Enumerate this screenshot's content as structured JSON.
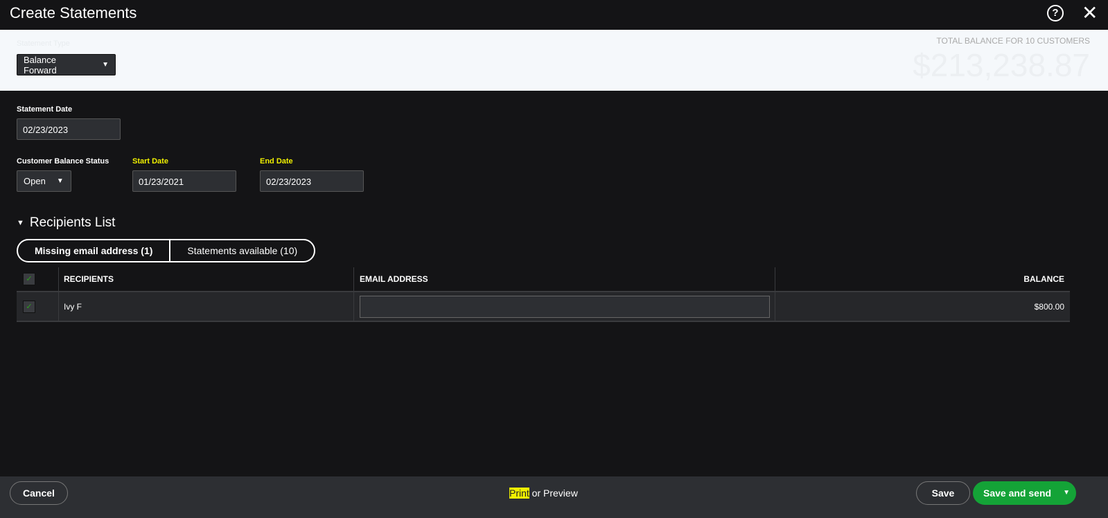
{
  "header": {
    "title": "Create Statements",
    "help_icon": "?",
    "close_icon": "✕"
  },
  "statement_type": {
    "label": "Statement Type",
    "value": "Balance Forward"
  },
  "total": {
    "label": "TOTAL BALANCE FOR 10 CUSTOMERS",
    "value": "$213,238.87"
  },
  "statement_date": {
    "label": "Statement Date",
    "value": "02/23/2023"
  },
  "balance_status": {
    "label": "Customer Balance Status",
    "value": "Open"
  },
  "start_date": {
    "label": "Start Date",
    "value": "01/23/2021"
  },
  "end_date": {
    "label": "End Date",
    "value": "02/23/2023"
  },
  "recipients": {
    "title": "Recipients List",
    "tabs": [
      {
        "label": "Missing email address (1)"
      },
      {
        "label": "Statements available (10)"
      }
    ],
    "columns": [
      "RECIPIENTS",
      "EMAIL ADDRESS",
      "BALANCE"
    ],
    "rows": [
      {
        "name": "Ivy F",
        "email": "",
        "balance": "$800.00"
      }
    ]
  },
  "footer": {
    "cancel": "Cancel",
    "print": "Print",
    "or_preview": " or Preview",
    "save": "Save",
    "save_send": "Save and send"
  }
}
